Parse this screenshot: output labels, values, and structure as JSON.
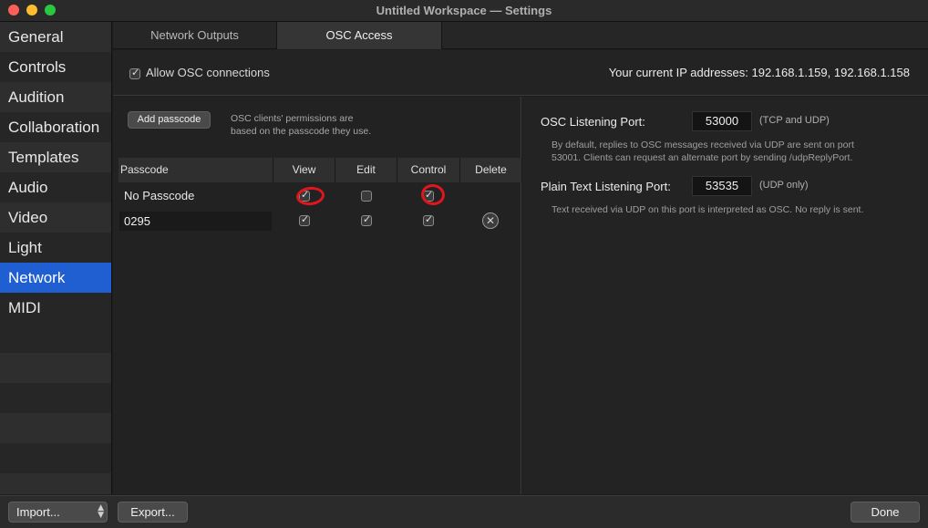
{
  "window": {
    "title": "Untitled Workspace — Settings"
  },
  "sidebar": {
    "items": [
      {
        "label": "General"
      },
      {
        "label": "Controls"
      },
      {
        "label": "Audition"
      },
      {
        "label": "Collaboration"
      },
      {
        "label": "Templates"
      },
      {
        "label": "Audio"
      },
      {
        "label": "Video"
      },
      {
        "label": "Light"
      },
      {
        "label": "Network",
        "active": true
      },
      {
        "label": "MIDI"
      }
    ]
  },
  "tabs": [
    {
      "label": "Network Outputs"
    },
    {
      "label": "OSC Access",
      "active": true
    }
  ],
  "osc": {
    "allow_label": "Allow OSC connections",
    "allow_checked": true,
    "ip_text": "Your current IP addresses: 192.168.1.159, 192.168.1.158",
    "add_passcode_label": "Add passcode",
    "permissions_note_line1": "OSC clients' permissions are",
    "permissions_note_line2": "based on the passcode they use."
  },
  "passcode_table": {
    "headers": [
      "Passcode",
      "View",
      "Edit",
      "Control",
      "Delete"
    ],
    "rows": [
      {
        "passcode": "No Passcode",
        "view": true,
        "edit": false,
        "control": true
      },
      {
        "passcode": "0295",
        "view": true,
        "edit": true,
        "control": true
      }
    ]
  },
  "ports": {
    "osc_label": "OSC Listening Port:",
    "osc_value": "53000",
    "osc_proto": "(TCP and UDP)",
    "osc_note_line1": "By default, replies to OSC messages received via UDP are sent on port",
    "osc_note_line2": "53001. Clients can request an alternate port by sending /udpReplyPort.",
    "plain_label": "Plain Text Listening Port:",
    "plain_value": "53535",
    "plain_proto": "(UDP only)",
    "plain_note": "Text received via UDP on this port is interpreted as OSC. No reply is sent."
  },
  "bottom": {
    "import_label": "Import...",
    "export_label": "Export...",
    "done_label": "Done"
  },
  "colors": {
    "accent": "#1f5fd1",
    "annotation": "#e0161c"
  }
}
